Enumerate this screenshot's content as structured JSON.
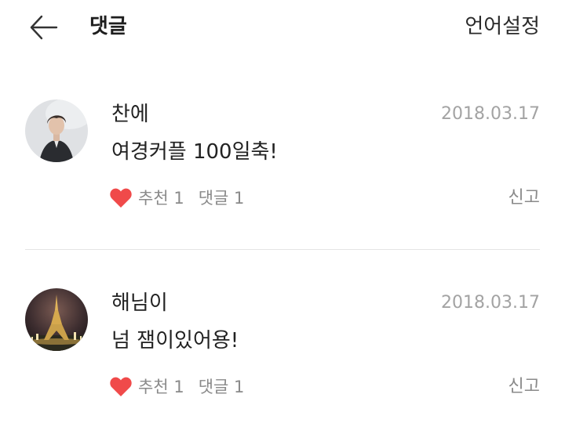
{
  "header": {
    "title": "댓글",
    "language_settings": "언어설정"
  },
  "comments": [
    {
      "author": "찬에",
      "date": "2018.03.17",
      "text": "여경커플 100일축!",
      "like_label": "추천 1",
      "reply_label": "댓글 1",
      "report_label": "신고"
    },
    {
      "author": "해님이",
      "date": "2018.03.17",
      "text": "넘 잼이있어용!",
      "like_label": "추천 1",
      "reply_label": "댓글 1",
      "report_label": "신고"
    }
  ],
  "colors": {
    "heart": "#f04a4a",
    "meta_text": "#8a8a8a",
    "date_text": "#a3a3a3",
    "divider": "#e4e4e4"
  },
  "icons": {
    "back": "arrow-left-icon",
    "like": "heart-icon"
  }
}
